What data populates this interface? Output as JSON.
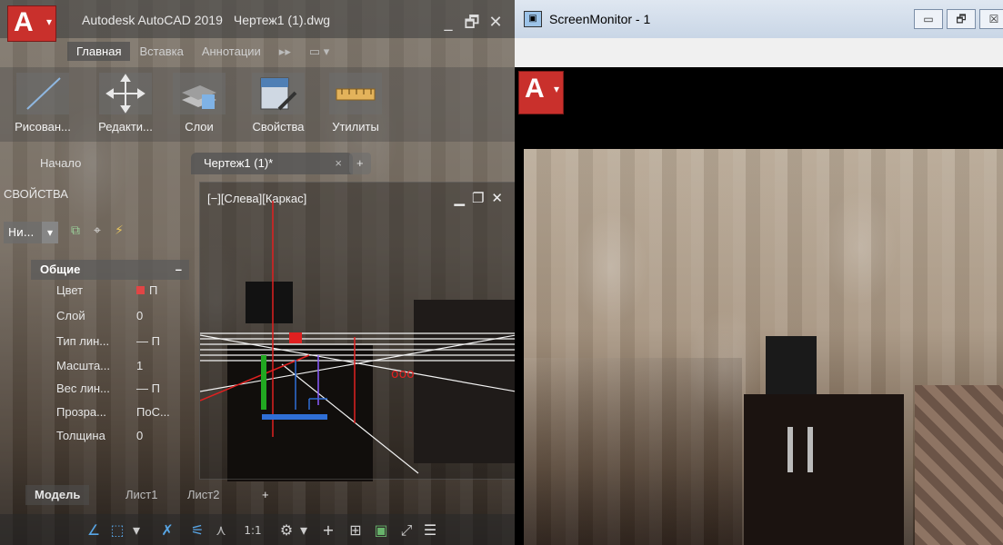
{
  "autocad": {
    "app_title": "Autodesk AutoCAD 2019",
    "doc_title": "Чертеж1 (1).dwg",
    "logo": "A",
    "ribbon_tabs": [
      "Главная",
      "Вставка",
      "Аннотации"
    ],
    "ribbon_more": "▸▸",
    "ribbon_buttons": [
      "Рисован...",
      "Редакти...",
      "Слои",
      "Свойства",
      "Утилиты"
    ],
    "file_tabs": {
      "start": "Начало",
      "drawing": "Чертеж1 (1)*",
      "close": "×",
      "new": "+"
    },
    "properties": {
      "title": "СВОЙСТВА",
      "selection": "Ни...",
      "group": "Общие",
      "group_toggle": "–",
      "rows": [
        {
          "key": "Цвет",
          "value": "П"
        },
        {
          "key": "Слой",
          "value": "0"
        },
        {
          "key": "Тип лин...",
          "value": "— П"
        },
        {
          "key": "Масшта...",
          "value": "1"
        },
        {
          "key": "Вес лин...",
          "value": "— П"
        },
        {
          "key": "Прозра...",
          "value": "ПоС..."
        },
        {
          "key": "Толщина",
          "value": "0"
        }
      ]
    },
    "viewport_label": "[−][Слева][Каркас]",
    "viewport_controls": {
      "minimize": "▁",
      "restore": "❐",
      "close": "✕"
    },
    "layout_tabs": [
      "Модель",
      "Лист1",
      "Лист2",
      "+"
    ],
    "status_scale": "1:1",
    "window_controls": {
      "minimize": "_",
      "restore": "🗗",
      "close": "✕"
    },
    "icons": [
      "line-icon",
      "move-icon",
      "layers-icon",
      "properties-icon",
      "measure-icon"
    ]
  },
  "screenmonitor": {
    "title": "ScreenMonitor - 1",
    "logo": "A",
    "buttons": {
      "minimize": "▭",
      "restore": "🗗",
      "close": "☒"
    }
  },
  "colors": {
    "accent": "#c9302c",
    "status_blue": "#58a6e6",
    "axis_red": "#e02020",
    "axis_green": "#21a821",
    "axis_blue": "#2f6fd6"
  }
}
